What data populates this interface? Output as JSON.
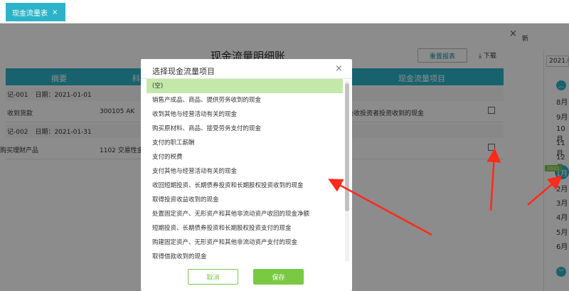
{
  "tabbar": {
    "tab_label": "现金流量表",
    "tab_close": "×"
  },
  "background": {
    "close": "×",
    "title": "现金流量明细账",
    "reset_button": "重置报表",
    "download": "下载",
    "refresh": "新",
    "columns": {
      "summary": "摘要",
      "subject": "科",
      "cashflow_item": "现金流量项目"
    },
    "entries": [
      {
        "voucher": "记-001",
        "date_label": "日期：2021-01-01",
        "summary": "收到货款",
        "subject": "300105 AK",
        "cashflow_item": "吸收投资者投资收到的现金"
      },
      {
        "voucher": "记-002",
        "date_label": "日期：2021-01-31",
        "summary": "购买理财产品",
        "subject": "1102 交易性金",
        "cashflow_item": ""
      }
    ]
  },
  "date_panel": {
    "date_value": "2021.0",
    "months": [
      "8月",
      "9月",
      "10月",
      "11月",
      "12月",
      "2月",
      "3月",
      "4月",
      "5月",
      "6月"
    ],
    "year_badge": "2021",
    "current_month": "1月"
  },
  "modal": {
    "title": "选择现金流量项目",
    "close": "×",
    "items": [
      "(空)",
      "销售产成品、商品、提供劳务收到的现金",
      "收到其他与经营活动有关的现金",
      "购买原材料、商品、接受劳务支付的现金",
      "支付的职工薪酬",
      "支付的税费",
      "支付其他与经营活动有关的现金",
      "收回短期投资、长期债券投资和长期股权投资收到的现金",
      "取得投资收益收到的现金",
      "处置固定资产、无形资产和其他非流动资产收回的现金净额",
      "短期投资、长期债券投资和长期股权投资支付的现金",
      "购建固定资产、无形资产和其他非流动资产支付的现金",
      "取得借款收到的现金"
    ],
    "selected_index": 0,
    "cancel_label": "取消",
    "save_label": "保存"
  },
  "colors": {
    "accent": "#2db3c9",
    "green": "#7ac943",
    "selected_bg": "#c3e8a9",
    "arrow": "#ff2a1a"
  }
}
